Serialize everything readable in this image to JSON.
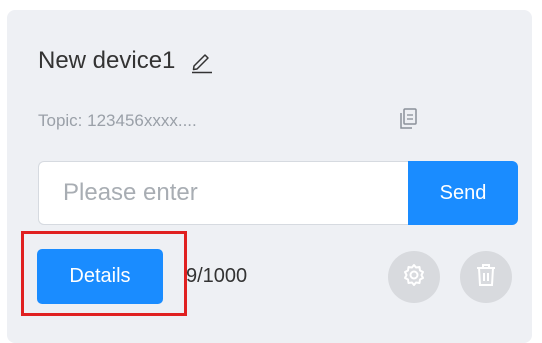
{
  "device": {
    "name": "New device1",
    "topic": "Topic: 123456xxxx...."
  },
  "message": {
    "placeholder": "Please enter",
    "send_label": "Send"
  },
  "footer": {
    "details_label": "Details",
    "counter": "9/1000"
  },
  "icons": {
    "edit": "pencil-icon",
    "copy": "copy-icon",
    "settings": "gear-icon",
    "delete": "trash-icon"
  },
  "colors": {
    "primary": "#1a8cff",
    "card_bg": "#eef0f4",
    "highlight": "#e02020",
    "round_button_bg": "#d8dade"
  }
}
